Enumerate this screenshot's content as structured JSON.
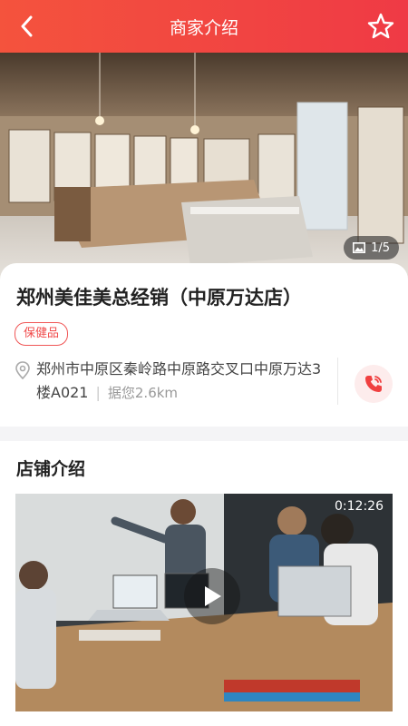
{
  "header": {
    "title": "商家介绍"
  },
  "gallery": {
    "counter": "1/5"
  },
  "store": {
    "name": "郑州美佳美总经销（中原万达店）",
    "tag": "保健品",
    "address": "郑州市中原区秦岭路中原路交叉口中原万达3楼A021",
    "distance": "据您2.6km"
  },
  "intro": {
    "title": "店铺介绍",
    "video_duration": "0:12:26"
  },
  "colors": {
    "accent": "#ef3a45",
    "header_start": "#f4533d"
  },
  "icons": {
    "back": "back-arrow-icon",
    "favorite": "star-icon",
    "gallery": "image-icon",
    "location": "location-pin-icon",
    "phone": "phone-icon",
    "play": "play-icon"
  }
}
